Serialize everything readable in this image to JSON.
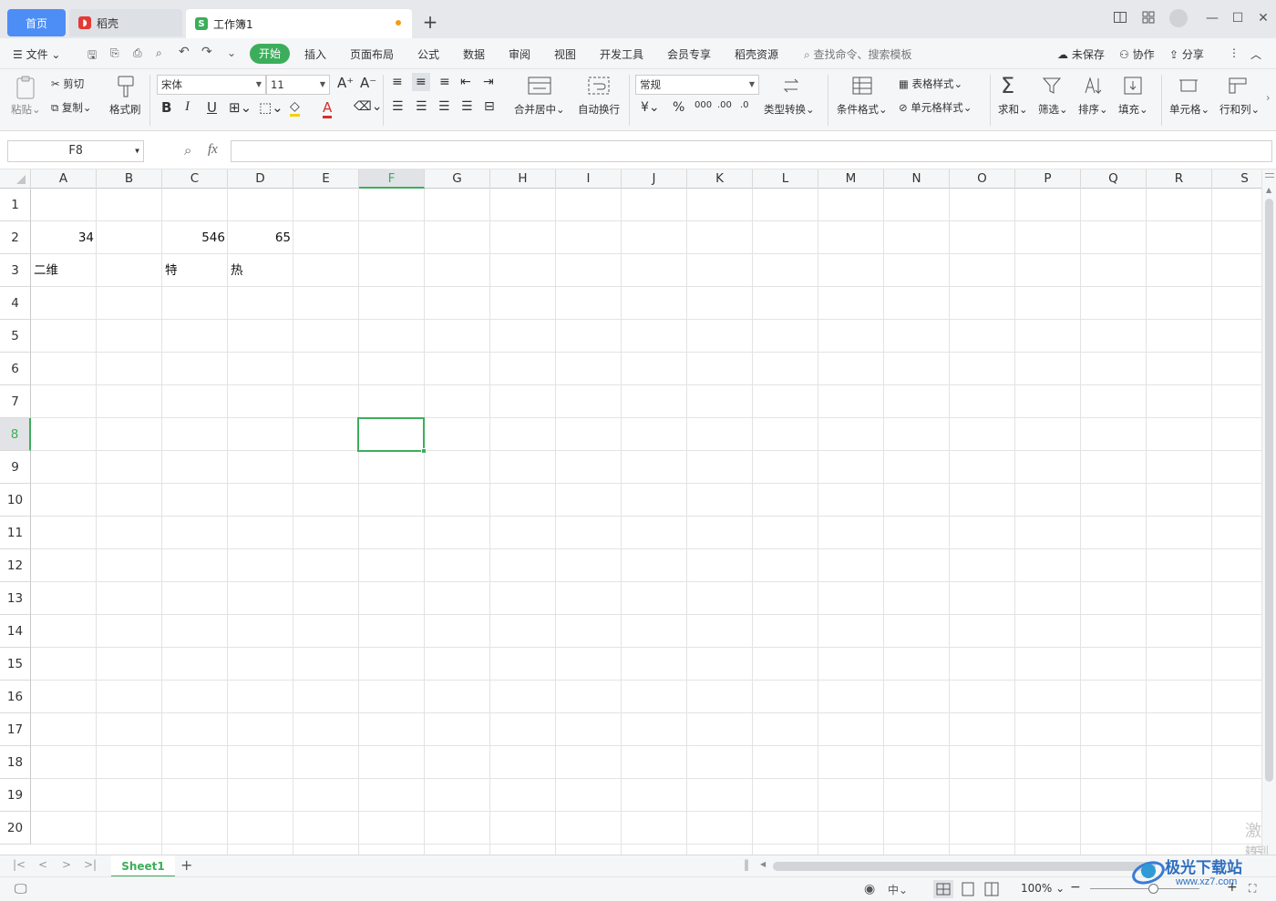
{
  "tabs": {
    "home": "首页",
    "docer": "稻壳",
    "workbook": "工作簿1"
  },
  "menu": {
    "file": "文件",
    "start": "开始",
    "insert": "插入",
    "page_layout": "页面布局",
    "formula": "公式",
    "data": "数据",
    "review": "审阅",
    "view": "视图",
    "developer": "开发工具",
    "member": "会员专享",
    "docer_res": "稻壳资源",
    "search_placeholder": "查找命令、搜索模板",
    "unsaved": "未保存",
    "collab": "协作",
    "share": "分享"
  },
  "ribbon": {
    "paste": "粘贴",
    "cut": "剪切",
    "copy": "复制",
    "format_painter": "格式刷",
    "font_name": "宋体",
    "font_size": "11",
    "merge_center": "合并居中",
    "wrap": "自动换行",
    "number_format": "常规",
    "type_convert": "类型转换",
    "cond_format": "条件格式",
    "table_style": "表格样式",
    "cell_style": "单元格样式",
    "sum": "求和",
    "filter": "筛选",
    "sort": "排序",
    "fill": "填充",
    "cell": "单元格",
    "row_col": "行和列"
  },
  "formula_bar": {
    "name_box": "F8",
    "fx": "fx",
    "value": ""
  },
  "columns": [
    "A",
    "B",
    "C",
    "D",
    "E",
    "F",
    "G",
    "H",
    "I",
    "J",
    "K",
    "L",
    "M",
    "N",
    "O",
    "P",
    "Q",
    "R",
    "S"
  ],
  "selected_column": "F",
  "rows": [
    "1",
    "2",
    "3",
    "4",
    "5",
    "6",
    "7",
    "8",
    "9",
    "10",
    "11",
    "12",
    "13",
    "14",
    "15",
    "16",
    "17",
    "18",
    "19",
    "20"
  ],
  "selected_row": "8",
  "cells": {
    "A2": "34",
    "C2": "546",
    "D2": "65",
    "A3": "二维",
    "C3": "特",
    "D3": "热"
  },
  "sheets": [
    "Sheet1"
  ],
  "status": {
    "zoom": "100%"
  },
  "watermark": {
    "line1": "激活",
    "line2": "转到",
    "brand": "极光下载站",
    "url": "www.xz7.com"
  },
  "colors": {
    "accent_green": "#3cae5b",
    "home_tab_blue": "#4d8df6"
  }
}
